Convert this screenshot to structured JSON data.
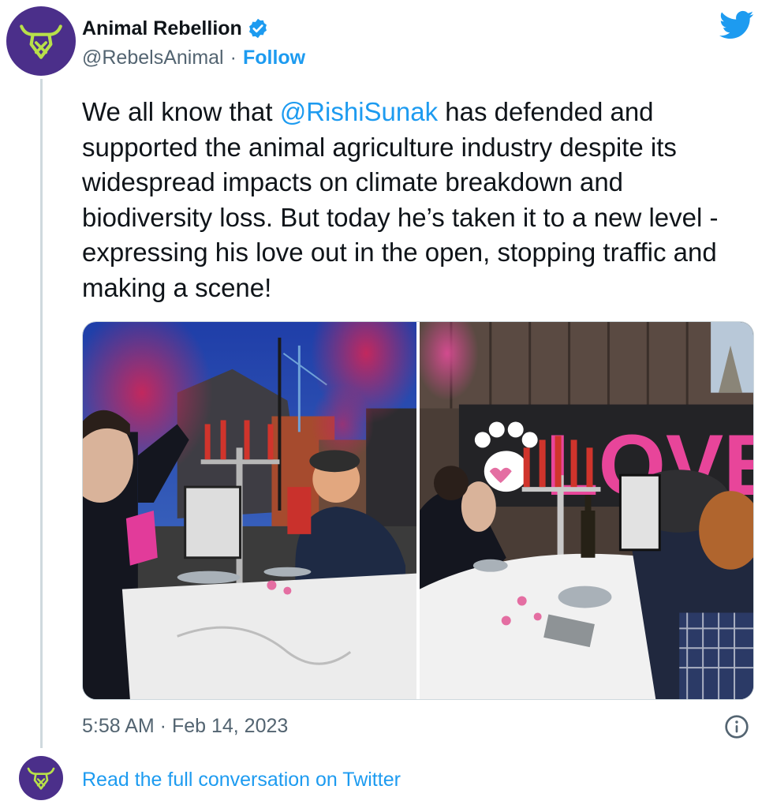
{
  "author": {
    "name": "Animal Rebellion",
    "handle": "@RebelsAnimal",
    "separator": "·",
    "follow_label": "Follow"
  },
  "tweet": {
    "text_before": "We all know that ",
    "mention": "@RishiSunak",
    "text_after": " has defended and supported the animal agriculture industry despite its widespread impacts on climate breakdown and biodiversity loss. But today he’s taken it to a new level - expressing his love out in the open, stopping traffic and making a scene!"
  },
  "photo_sign_text": "LOVE",
  "timestamp": "5:58 AM · Feb 14, 2023",
  "footer": {
    "read_link": "Read the full conversation on Twitter"
  },
  "icons": {
    "avatar": "bull-head-logo-icon",
    "verified": "verified-badge-icon",
    "bird": "twitter-bird-icon",
    "info": "info-icon"
  },
  "colors": {
    "accent": "#1d9bf0",
    "avatar_bg": "#4b2f8a",
    "logo": "#b8e04a",
    "text": "#0f1419",
    "muted": "#536471"
  }
}
